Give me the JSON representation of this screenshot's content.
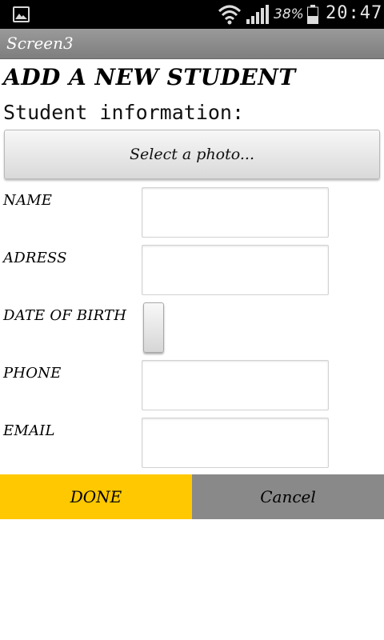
{
  "status_bar": {
    "battery_percent": "38%",
    "time": "20:47",
    "icons": [
      "image-icon",
      "wifi-icon",
      "signal-icon",
      "battery-icon"
    ]
  },
  "title_bar": {
    "title": "Screen3"
  },
  "page": {
    "heading": "ADD A NEW STUDENT",
    "section_label": "Student information:",
    "photo_button_label": "Select a photo..."
  },
  "form": {
    "name_label": "NAME",
    "name_value": "",
    "address_label": "ADRESS",
    "address_value": "",
    "dob_label": "DATE OF BIRTH",
    "phone_label": "PHONE",
    "phone_value": "",
    "email_label": "EMAIL",
    "email_value": ""
  },
  "actions": {
    "done_label": "DONE",
    "cancel_label": "Cancel",
    "done_color": "#ffc800",
    "cancel_color": "#898989"
  }
}
